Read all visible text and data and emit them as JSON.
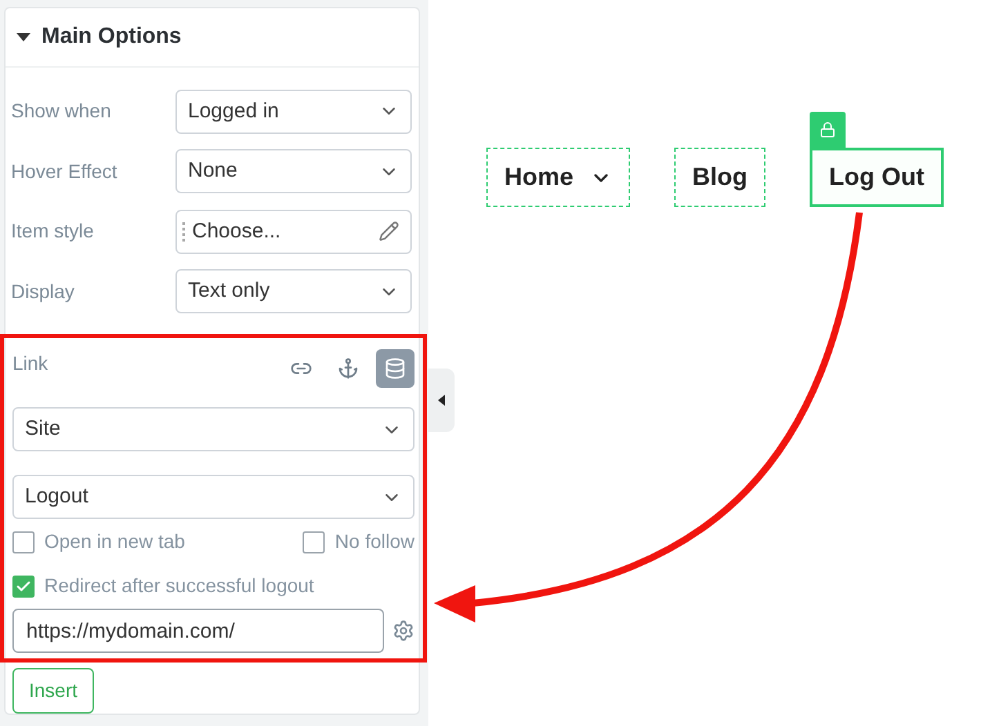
{
  "panel": {
    "title": "Main Options",
    "expanded": true,
    "fields": [
      {
        "label": "Show when",
        "kind": "select",
        "value": "Logged in"
      },
      {
        "label": "Hover Effect",
        "kind": "select",
        "value": "None"
      },
      {
        "label": "Item style",
        "kind": "picker",
        "value": "Choose..."
      },
      {
        "label": "Display",
        "kind": "select",
        "value": "Text only"
      }
    ],
    "link": {
      "label": "Link",
      "types": [
        {
          "kind": "url",
          "selected": false
        },
        {
          "kind": "anchor",
          "selected": false
        },
        {
          "kind": "dynamic",
          "selected": true
        }
      ],
      "selects": [
        "Site",
        "Logout"
      ],
      "options": [
        {
          "label": "Open in new tab",
          "checked": false
        },
        {
          "label": "No follow",
          "checked": false
        }
      ],
      "redirect": {
        "label": "Redirect after successful logout",
        "checked": true
      },
      "url": "https://mydomain.com/"
    },
    "insert_button": "Insert"
  },
  "menu": [
    {
      "label": "Home",
      "dropdown": true,
      "selected": false,
      "locked": false
    },
    {
      "label": "Blog",
      "dropdown": false,
      "selected": false,
      "locked": false
    },
    {
      "label": "Log Out",
      "dropdown": false,
      "selected": true,
      "locked": true
    }
  ]
}
